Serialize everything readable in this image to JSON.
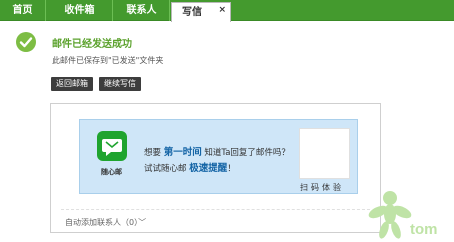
{
  "tabs": [
    {
      "label": "首页"
    },
    {
      "label": "收件箱"
    },
    {
      "label": "联系人"
    },
    {
      "label": "写信",
      "active": true
    }
  ],
  "tab_close": "×",
  "success": {
    "title": "邮件已经发送成功",
    "subtitle": "此邮件已保存到\"已发送\"文件夹"
  },
  "buttons": {
    "back": "返回邮箱",
    "continue": "继续写信"
  },
  "promo": {
    "app_name": "随心邮",
    "line1_pre": "想要 ",
    "line1_bold": "第一时间",
    "line1_post": " 知道Ta回复了邮件吗？",
    "line2_pre": "试试随心邮 ",
    "line2_bold": "极速提醒",
    "line2_post": "！",
    "qr_label": "扫码体验"
  },
  "contacts": {
    "label": "自动添加联系人（0）",
    "chevron": "﹀"
  },
  "logo": {
    "text": "tom"
  },
  "colors": {
    "tab_bar": "#449a2e",
    "success_green": "#7dbd44",
    "button": "#3d3d3d",
    "banner": "#cfe6f8",
    "app_icon": "#1fa42f"
  }
}
